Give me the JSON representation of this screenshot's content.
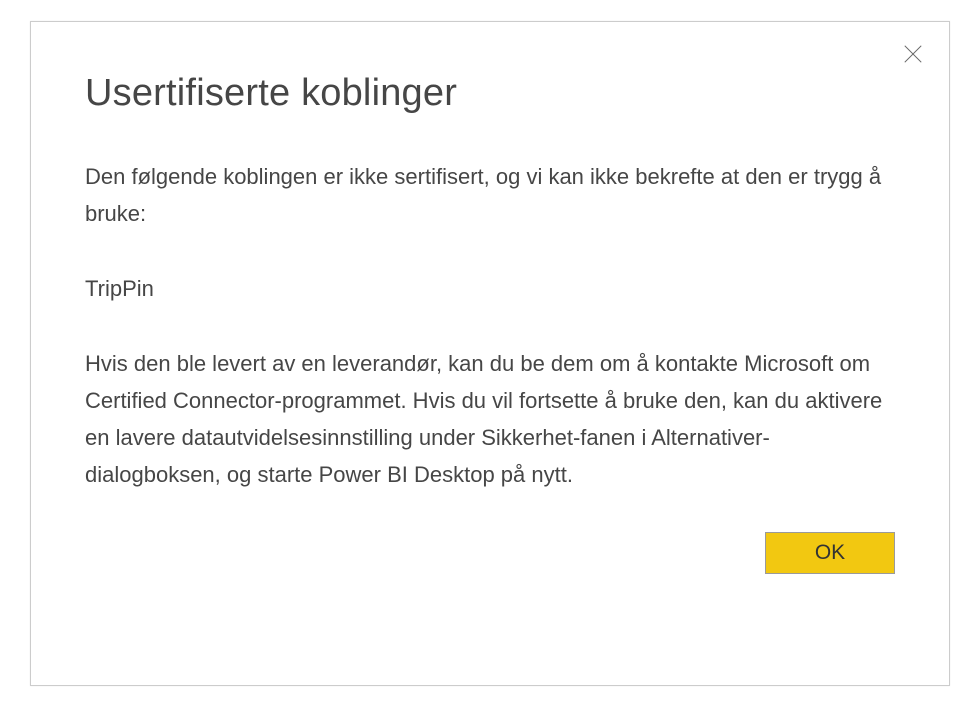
{
  "dialog": {
    "title": "Usertifiserte koblinger",
    "intro": "Den følgende koblingen er ikke sertifisert, og vi kan ikke bekrefte at den er trygg å bruke:",
    "connector_name": "TripPin",
    "details": "Hvis den ble levert av en leverandør, kan du be dem om å kontakte Microsoft om Certified Connector-programmet. Hvis du vil fortsette å bruke den, kan du aktivere en lavere datautvidelsesinnstilling under Sikkerhet-fanen i Alternativer-dialogboksen, og starte Power BI Desktop på nytt.",
    "ok_label": "OK"
  }
}
